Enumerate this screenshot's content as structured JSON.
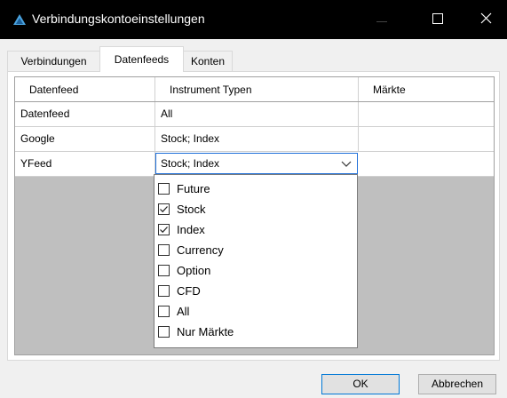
{
  "window": {
    "title": "Verbindungskontoeinstellungen"
  },
  "tabs": [
    {
      "label": "Verbindungen",
      "active": false
    },
    {
      "label": "Datenfeeds",
      "active": true
    },
    {
      "label": "Konten",
      "active": false
    }
  ],
  "table": {
    "headers": [
      "Datenfeed",
      "Instrument Typen",
      "Märkte"
    ],
    "rows": [
      {
        "datenfeed": "Datenfeed",
        "instrument_typen": "All",
        "maerkte": ""
      },
      {
        "datenfeed": "Google",
        "instrument_typen": "Stock; Index",
        "maerkte": ""
      },
      {
        "datenfeed": "YFeed",
        "instrument_typen": "Stock; Index",
        "maerkte": ""
      }
    ]
  },
  "dropdown": {
    "options": [
      {
        "label": "Future",
        "checked": false
      },
      {
        "label": "Stock",
        "checked": true
      },
      {
        "label": "Index",
        "checked": true
      },
      {
        "label": "Currency",
        "checked": false
      },
      {
        "label": "Option",
        "checked": false
      },
      {
        "label": "CFD",
        "checked": false
      },
      {
        "label": "All",
        "checked": false
      },
      {
        "label": "Nur Märkte",
        "checked": false
      }
    ]
  },
  "buttons": {
    "ok": "OK",
    "cancel": "Abbrechen"
  },
  "colors": {
    "titlebar": "#000000",
    "focus_border": "#1e6fd9",
    "grid_background": "#bfbfbf"
  },
  "icons": {
    "app": "app-triangle-icon",
    "minimize": "minimize-icon",
    "maximize": "maximize-icon",
    "close": "close-icon"
  }
}
